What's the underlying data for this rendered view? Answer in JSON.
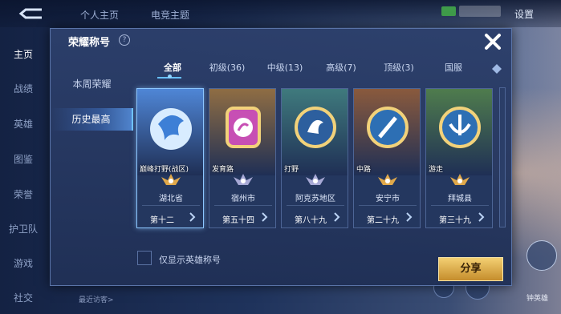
{
  "top_bar": {
    "tabs": [
      "个人主页",
      "电竞主题"
    ],
    "settings_label": "设置"
  },
  "left_nav": {
    "items": [
      "主页",
      "战绩",
      "英雄",
      "图鉴",
      "荣誉",
      "护卫队",
      "游戏",
      "社交"
    ]
  },
  "footer": {
    "visit_text": "最近访客>"
  },
  "right_controls": {
    "label": "钟英雄"
  },
  "dialog": {
    "title": "荣耀称号",
    "help_icon": "?",
    "close_icon": "close-icon",
    "side_tabs": [
      "本周荣耀",
      "历史最高"
    ],
    "active_side_tab": "历史最高",
    "tabs": [
      "全部",
      "初级(36)",
      "中级(13)",
      "高级(7)",
      "顶级(3)",
      "国服"
    ],
    "active_tab": "全部",
    "cards": [
      {
        "role": "巅峰打野(战区)",
        "region": "湖北省",
        "rank": "第十二",
        "theme": "#4f86d6",
        "emblem": "dragon",
        "rank_color": "#e0a84a"
      },
      {
        "role": "发育路",
        "region": "宿州市",
        "rank": "第五十四",
        "theme": "#8f6d43",
        "emblem": "marksman",
        "rank_color": "#a7a9d6"
      },
      {
        "role": "打野",
        "region": "阿克苏地区",
        "rank": "第八十九",
        "theme": "#3f7a7d",
        "emblem": "jungle",
        "rank_color": "#a7a9d6"
      },
      {
        "role": "中路",
        "region": "安宁市",
        "rank": "第二十九",
        "theme": "#8a5a3d",
        "emblem": "mid",
        "rank_color": "#e0a84a"
      },
      {
        "role": "游走",
        "region": "拜城县",
        "rank": "第三十九",
        "theme": "#4f7c4d",
        "emblem": "support",
        "rank_color": "#e0a84a"
      }
    ],
    "checkbox_label": "仅显示英雄称号",
    "checkbox_checked": false,
    "share_label": "分享"
  },
  "colors": {
    "accent": "#67bfff",
    "share_gold": "#e2b453"
  }
}
